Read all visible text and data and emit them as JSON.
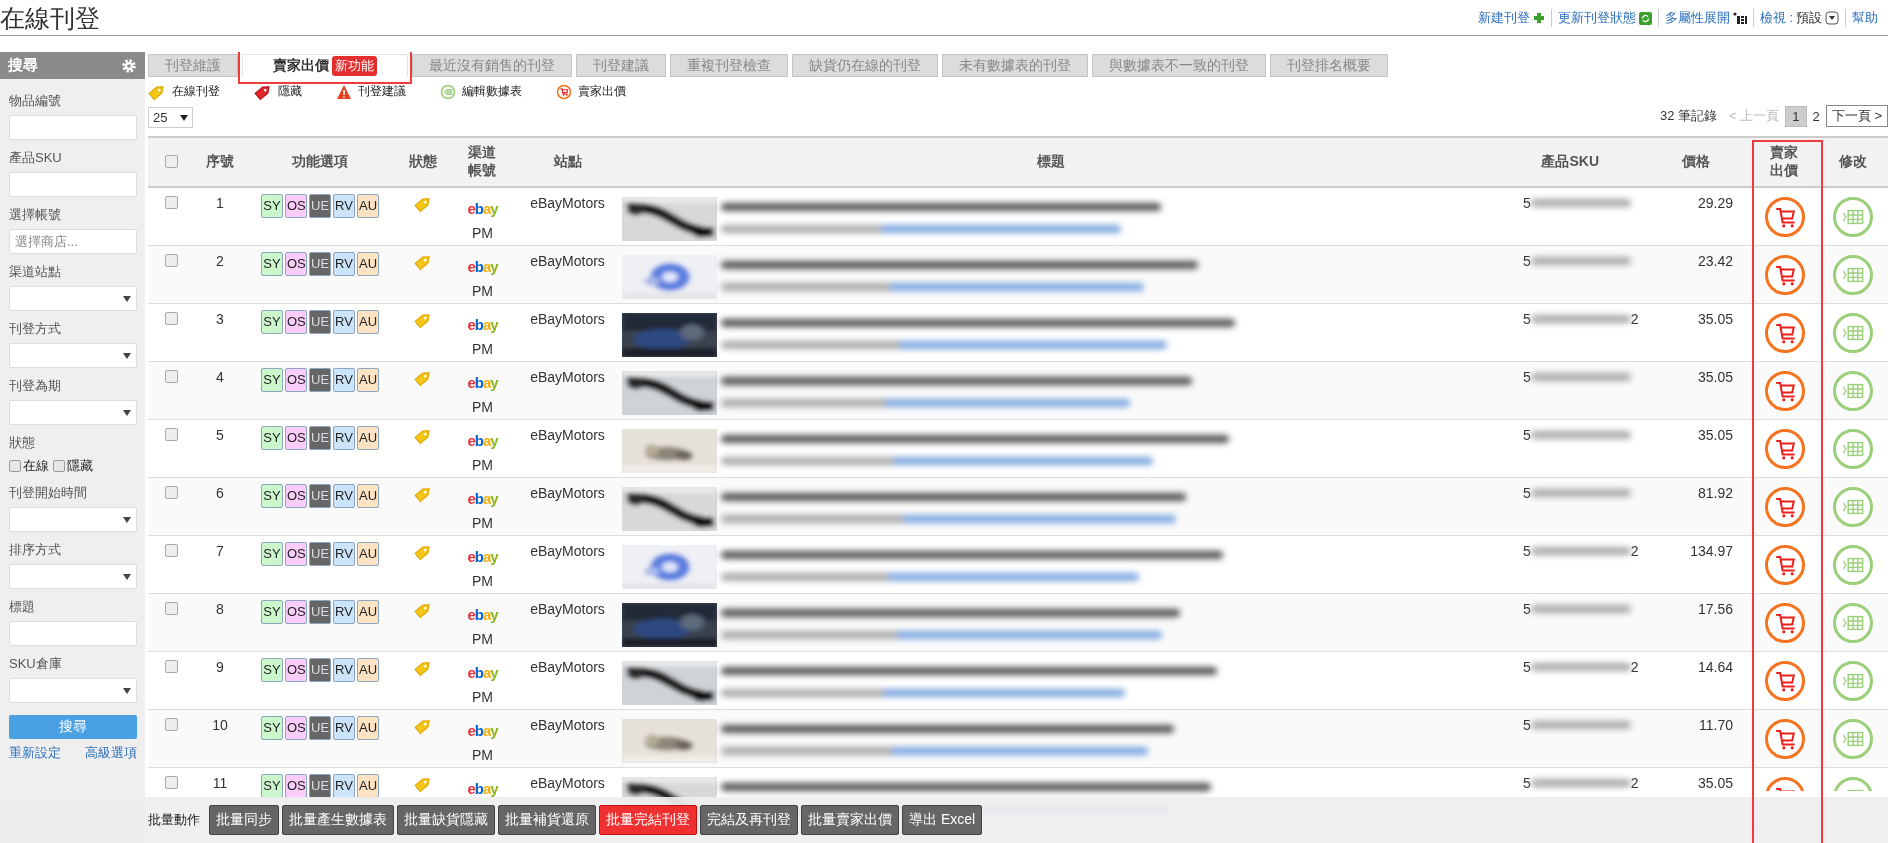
{
  "page_title": "在線刊登",
  "toolbar_links": [
    {
      "kind": "new",
      "label": "新建刊登"
    },
    {
      "kind": "refresh",
      "label": "更新刊登狀態"
    },
    {
      "kind": "expand",
      "label": "多屬性展開"
    },
    {
      "kind": "view",
      "label": "檢視 :",
      "value": "預設"
    },
    {
      "kind": "help",
      "label": "幫助"
    }
  ],
  "sidebar": {
    "title": "搜尋",
    "fields": [
      {
        "kind": "text",
        "label": "物品編號"
      },
      {
        "kind": "text",
        "label": "產品SKU"
      },
      {
        "kind": "text",
        "label": "選擇帳號",
        "placeholder": "選擇商店..."
      },
      {
        "kind": "select",
        "label": "渠道站點"
      },
      {
        "kind": "select",
        "label": "刊登方式"
      },
      {
        "kind": "select",
        "label": "刊登為期"
      },
      {
        "kind": "checks",
        "label": "狀態",
        "options": [
          {
            "label": "在線",
            "checked": false
          },
          {
            "label": "隱藏",
            "checked": false
          }
        ]
      },
      {
        "kind": "select",
        "label": "刊登開始時間"
      },
      {
        "kind": "select",
        "label": "排序方式"
      },
      {
        "kind": "text",
        "label": "標題"
      },
      {
        "kind": "select",
        "label": "SKU倉庫"
      }
    ],
    "search_button": "搜尋",
    "links": [
      "重新設定",
      "高級選項"
    ]
  },
  "tabs": [
    {
      "label": "刊登維護",
      "selected": false
    },
    {
      "label": "賣家出價",
      "selected": true,
      "badge": "新功能",
      "highlighted": true
    },
    {
      "label": "最近沒有銷售的刊登",
      "selected": false
    },
    {
      "label": "刊登建議",
      "selected": false
    },
    {
      "label": "重複刊登檢查",
      "selected": false
    },
    {
      "label": "缺貨仍在線的刊登",
      "selected": false
    },
    {
      "label": "未有數據表的刊登",
      "selected": false
    },
    {
      "label": "與數據表不一致的刊登",
      "selected": false
    },
    {
      "label": "刊登排名概要",
      "selected": false
    }
  ],
  "legend": [
    {
      "kind": "online",
      "label": "在線刊登"
    },
    {
      "kind": "hidden",
      "label": "隱藏"
    },
    {
      "kind": "warning",
      "label": "刊登建議"
    },
    {
      "kind": "sheet",
      "label": "編輯數據表"
    },
    {
      "kind": "bid",
      "label": "賣家出價"
    }
  ],
  "page_size": "25",
  "pagination": {
    "total": "32 筆記錄",
    "prev": "< 上一頁",
    "prev_disabled": true,
    "pages": [
      {
        "label": "1",
        "selected": true
      },
      {
        "label": "2",
        "selected": false
      }
    ],
    "next": "下一頁 >"
  },
  "table": {
    "header_checked": false,
    "columns": [
      {
        "kind": "seq",
        "label": "序號"
      },
      {
        "kind": "functions",
        "label": "功能選項"
      },
      {
        "kind": "status",
        "label": "狀態"
      },
      {
        "kind": "account",
        "label": "渠道帳號"
      },
      {
        "kind": "site",
        "label": "站點"
      },
      {
        "kind": "title",
        "label": "標題"
      },
      {
        "kind": "sku",
        "label": "產品SKU"
      },
      {
        "kind": "price",
        "label": "價格"
      },
      {
        "kind": "bid",
        "label": "賣家出價",
        "highlighted": true
      },
      {
        "kind": "edit",
        "label": "修改"
      }
    ],
    "rows": [
      {
        "seq": "1",
        "checked": false,
        "functions": [
          {
            "label": "SY",
            "color": "#ccf7cc"
          },
          {
            "label": "OS",
            "color": "#f9ccf9"
          },
          {
            "label": "UE",
            "color": "#666666"
          },
          {
            "label": "RV",
            "color": "#cce4fa"
          },
          {
            "label": "AU",
            "color": "#fde2c4"
          }
        ],
        "status": {
          "kind": "online"
        },
        "channel": "ebay",
        "account": "PM",
        "site": "eBayMotors",
        "sku": "5",
        "price": "29.29"
      },
      {
        "seq": "2",
        "checked": false,
        "functions": [
          {
            "label": "SY",
            "color": "#ccf7cc"
          },
          {
            "label": "OS",
            "color": "#f9ccf9"
          },
          {
            "label": "UE",
            "color": "#666666"
          },
          {
            "label": "RV",
            "color": "#cce4fa"
          },
          {
            "label": "AU",
            "color": "#fde2c4"
          }
        ],
        "status": {
          "kind": "online"
        },
        "channel": "ebay",
        "account": "PM",
        "site": "eBayMotors",
        "sku": "5",
        "price": "23.42"
      },
      {
        "seq": "3",
        "checked": false,
        "functions": [
          {
            "label": "SY",
            "color": "#ccf7cc"
          },
          {
            "label": "OS",
            "color": "#f9ccf9"
          },
          {
            "label": "UE",
            "color": "#666666"
          },
          {
            "label": "RV",
            "color": "#cce4fa"
          },
          {
            "label": "AU",
            "color": "#fde2c4"
          }
        ],
        "status": {
          "kind": "online"
        },
        "channel": "ebay",
        "account": "PM",
        "site": "eBayMotors",
        "sku": "5",
        "sku_tail": "2",
        "price": "35.05"
      },
      {
        "seq": "4",
        "checked": false,
        "functions": [
          {
            "label": "SY",
            "color": "#ccf7cc"
          },
          {
            "label": "OS",
            "color": "#f9ccf9"
          },
          {
            "label": "UE",
            "color": "#666666"
          },
          {
            "label": "RV",
            "color": "#cce4fa"
          },
          {
            "label": "AU",
            "color": "#fde2c4"
          }
        ],
        "status": {
          "kind": "online"
        },
        "channel": "ebay",
        "account": "PM",
        "site": "eBayMotors",
        "sku": "5",
        "price": "35.05"
      },
      {
        "seq": "5",
        "checked": false,
        "functions": [
          {
            "label": "SY",
            "color": "#ccf7cc"
          },
          {
            "label": "OS",
            "color": "#f9ccf9"
          },
          {
            "label": "UE",
            "color": "#666666"
          },
          {
            "label": "RV",
            "color": "#cce4fa"
          },
          {
            "label": "AU",
            "color": "#fde2c4"
          }
        ],
        "status": {
          "kind": "online"
        },
        "channel": "ebay",
        "account": "PM",
        "site": "eBayMotors",
        "sku": "5",
        "price": "35.05"
      },
      {
        "seq": "6",
        "checked": false,
        "functions": [
          {
            "label": "SY",
            "color": "#ccf7cc"
          },
          {
            "label": "OS",
            "color": "#f9ccf9"
          },
          {
            "label": "UE",
            "color": "#666666"
          },
          {
            "label": "RV",
            "color": "#cce4fa"
          },
          {
            "label": "AU",
            "color": "#fde2c4"
          }
        ],
        "status": {
          "kind": "online"
        },
        "channel": "ebay",
        "account": "PM",
        "site": "eBayMotors",
        "sku": "5",
        "price": "81.92"
      },
      {
        "seq": "7",
        "checked": false,
        "functions": [
          {
            "label": "SY",
            "color": "#ccf7cc"
          },
          {
            "label": "OS",
            "color": "#f9ccf9"
          },
          {
            "label": "UE",
            "color": "#666666"
          },
          {
            "label": "RV",
            "color": "#cce4fa"
          },
          {
            "label": "AU",
            "color": "#fde2c4"
          }
        ],
        "status": {
          "kind": "online"
        },
        "channel": "ebay",
        "account": "PM",
        "site": "eBayMotors",
        "sku": "5",
        "sku_tail": "2",
        "price": "134.97"
      },
      {
        "seq": "8",
        "checked": false,
        "functions": [
          {
            "label": "SY",
            "color": "#ccf7cc"
          },
          {
            "label": "OS",
            "color": "#f9ccf9"
          },
          {
            "label": "UE",
            "color": "#666666"
          },
          {
            "label": "RV",
            "color": "#cce4fa"
          },
          {
            "label": "AU",
            "color": "#fde2c4"
          }
        ],
        "status": {
          "kind": "online"
        },
        "channel": "ebay",
        "account": "PM",
        "site": "eBayMotors",
        "sku": "5",
        "price": "17.56"
      },
      {
        "seq": "9",
        "checked": false,
        "functions": [
          {
            "label": "SY",
            "color": "#ccf7cc"
          },
          {
            "label": "OS",
            "color": "#f9ccf9"
          },
          {
            "label": "UE",
            "color": "#666666"
          },
          {
            "label": "RV",
            "color": "#cce4fa"
          },
          {
            "label": "AU",
            "color": "#fde2c4"
          }
        ],
        "status": {
          "kind": "online"
        },
        "channel": "ebay",
        "account": "PM",
        "site": "eBayMotors",
        "sku": "5",
        "sku_tail": "2",
        "price": "14.64"
      },
      {
        "seq": "10",
        "checked": false,
        "functions": [
          {
            "label": "SY",
            "color": "#ccf7cc"
          },
          {
            "label": "OS",
            "color": "#f9ccf9"
          },
          {
            "label": "UE",
            "color": "#666666"
          },
          {
            "label": "RV",
            "color": "#cce4fa"
          },
          {
            "label": "AU",
            "color": "#fde2c4"
          }
        ],
        "status": {
          "kind": "online"
        },
        "channel": "ebay",
        "account": "PM",
        "site": "eBayMotors",
        "sku": "5",
        "price": "11.70"
      },
      {
        "seq": "11",
        "checked": false,
        "functions": [
          {
            "label": "SY",
            "color": "#ccf7cc"
          },
          {
            "label": "OS",
            "color": "#f9ccf9"
          },
          {
            "label": "UE",
            "color": "#666666"
          },
          {
            "label": "RV",
            "color": "#cce4fa"
          },
          {
            "label": "AU",
            "color": "#fde2c4"
          }
        ],
        "status": {
          "kind": "online"
        },
        "channel": "ebay",
        "site": "eBayMotors",
        "sku": "5",
        "sku_tail": "2",
        "price": "35.05"
      }
    ]
  },
  "bulk_bar": {
    "label": "批量動作",
    "buttons": [
      {
        "label": "批量同步",
        "kind": "normal"
      },
      {
        "label": "批量產生數據表",
        "kind": "normal"
      },
      {
        "label": "批量缺貨隱藏",
        "kind": "normal"
      },
      {
        "label": "批量補貨還原",
        "kind": "normal"
      },
      {
        "label": "批量完結刊登",
        "kind": "danger"
      },
      {
        "label": "完結及再刊登",
        "kind": "normal"
      },
      {
        "label": "批量賣家出價",
        "kind": "normal"
      },
      {
        "label": "導出 Excel",
        "kind": "normal"
      }
    ]
  }
}
